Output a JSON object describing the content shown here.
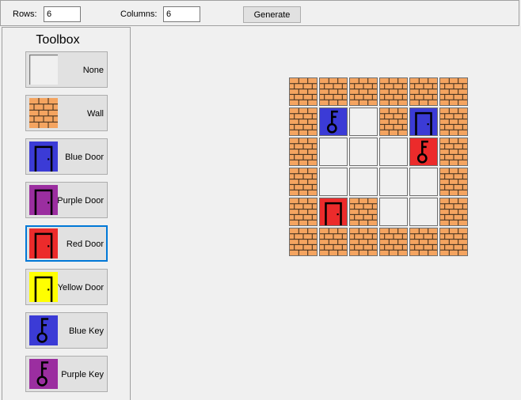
{
  "topbar": {
    "rows_label": "Rows:",
    "rows_value": "6",
    "columns_label": "Columns:",
    "columns_value": "6",
    "generate_label": "Generate"
  },
  "toolbox": {
    "title": "Toolbox",
    "selected": "red-door",
    "items": [
      {
        "id": "none",
        "label": "None",
        "icon": "empty-tile-icon"
      },
      {
        "id": "wall",
        "label": "Wall",
        "icon": "brick-wall-icon"
      },
      {
        "id": "blue-door",
        "label": "Blue Door",
        "icon": "blue-door-icon"
      },
      {
        "id": "purple-door",
        "label": "Purple Door",
        "icon": "purple-door-icon"
      },
      {
        "id": "red-door",
        "label": "Red Door",
        "icon": "red-door-icon"
      },
      {
        "id": "yellow-door",
        "label": "Yellow Door",
        "icon": "yellow-door-icon"
      },
      {
        "id": "blue-key",
        "label": "Blue Key",
        "icon": "blue-key-icon"
      },
      {
        "id": "purple-key",
        "label": "Purple Key",
        "icon": "purple-key-icon"
      }
    ]
  },
  "colors": {
    "brick": "#f4a460",
    "mortar": "#3a2a1a",
    "blue": "#3b3bd6",
    "purple": "#9b2ea0",
    "red": "#ec2b2b",
    "yellow": "#ffff00",
    "empty": "#f0f0f0",
    "selection": "#0078d7"
  },
  "grid": {
    "rows": 6,
    "columns": 6,
    "cells": [
      [
        "wall",
        "wall",
        "wall",
        "wall",
        "wall",
        "wall"
      ],
      [
        "wall",
        "blue-key",
        "none",
        "wall",
        "blue-door",
        "wall"
      ],
      [
        "wall",
        "none",
        "none",
        "none",
        "red-key",
        "wall"
      ],
      [
        "wall",
        "none",
        "none",
        "none",
        "none",
        "wall"
      ],
      [
        "wall",
        "red-door",
        "wall",
        "none",
        "none",
        "wall"
      ],
      [
        "wall",
        "wall",
        "wall",
        "wall",
        "wall",
        "wall"
      ]
    ]
  }
}
